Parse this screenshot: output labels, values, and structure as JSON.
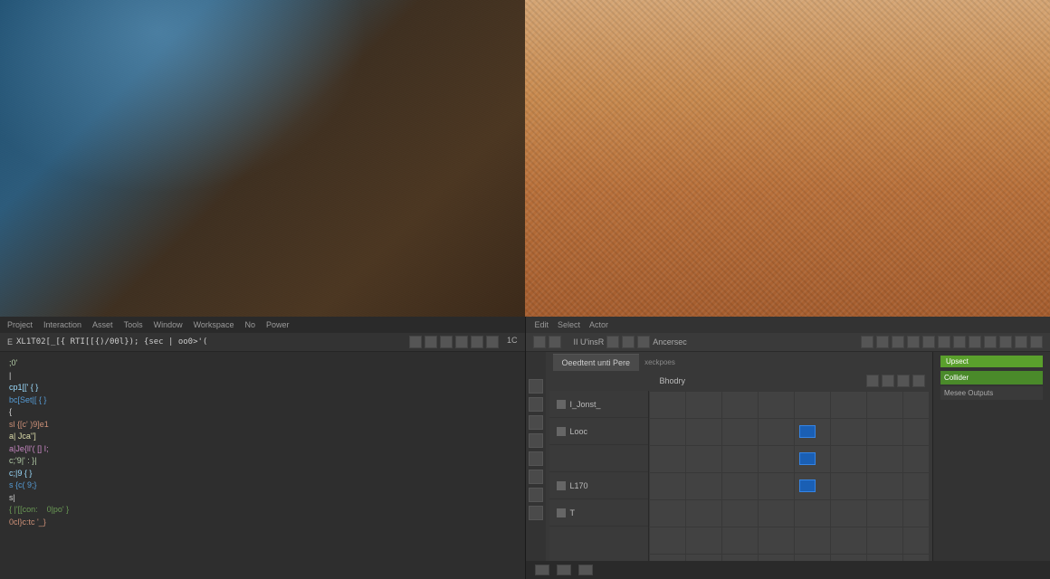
{
  "menubar": {
    "items": [
      "Project",
      "Interaction",
      "Asset",
      "Tools",
      "Window",
      "Workspace",
      "No",
      "Power"
    ]
  },
  "code_toolbar": {
    "expression": "XL1T02[_[{ RTI[[{)/00l});  {sec | oo0>'("
  },
  "code": {
    "lines": [
      {
        "t": ";0'",
        "c": "num"
      },
      {
        "t": "|",
        "c": "pun"
      },
      {
        "t": "cp1[[' { }",
        "c": "var"
      },
      {
        "t": "bc[Set|[ { }",
        "c": "kw"
      },
      {
        "t": "{",
        "c": "pun"
      },
      {
        "t": "sl {[c' )9]e1",
        "c": "str"
      },
      {
        "t": "a| Jca'']",
        "c": "fn2"
      },
      {
        "t": "a|Je{ll'( [] I;",
        "c": "op"
      },
      {
        "t": "c;'9|' : }|",
        "c": "num"
      },
      {
        "t": "c;|9 { }",
        "c": "var"
      },
      {
        "t": "s {c( 9;}",
        "c": "kw"
      },
      {
        "t": "s|",
        "c": "pun"
      },
      {
        "t": "{ |'[[con:    0|po' }",
        "c": "cm"
      },
      {
        "t": "0cl}c:tc '_}",
        "c": "str"
      }
    ]
  },
  "right_top": {
    "items": [
      "Edit",
      "Select",
      "Actor"
    ]
  },
  "timeline": {
    "tab": "Oeedtent unti Pere",
    "secondary": "xeckpoes",
    "prop_label": "Bhodry",
    "tracks": [
      {
        "label": "I_Jonst_",
        "icon": true
      },
      {
        "label": "Looc",
        "icon": true
      },
      {
        "label": "",
        "icon": false
      },
      {
        "label": "L170",
        "icon": true
      },
      {
        "label": "T",
        "icon": true
      }
    ],
    "keys": [
      {
        "row": 1,
        "col": 4
      },
      {
        "row": 2,
        "col": 4
      },
      {
        "row": 3,
        "col": 4
      }
    ]
  },
  "sidebar": {
    "header": "Upsect",
    "items": [
      "Collider",
      "Mesee Outputs"
    ]
  }
}
